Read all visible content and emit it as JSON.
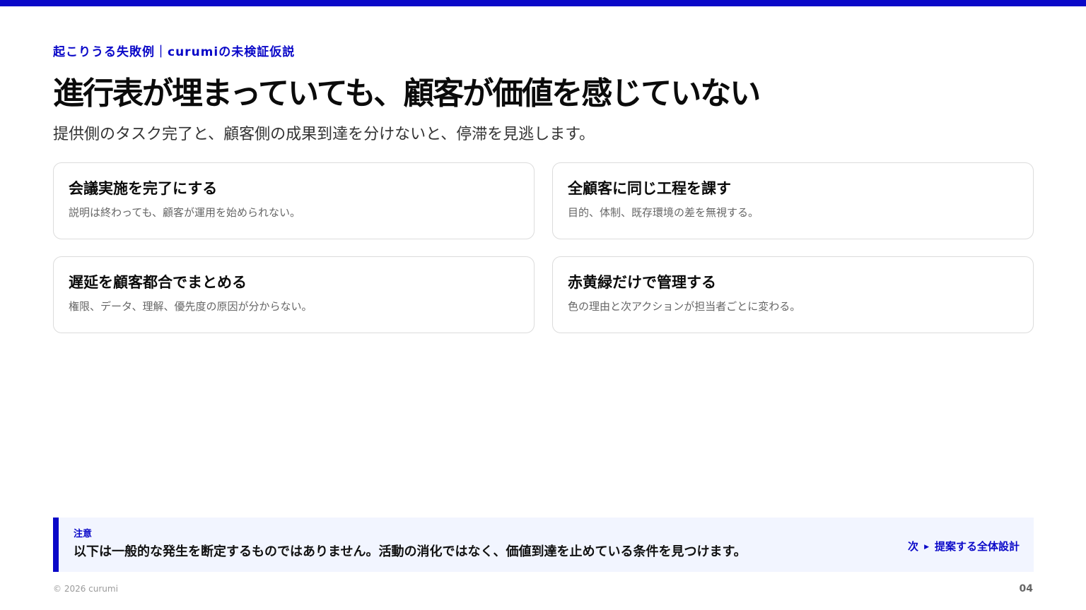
{
  "header": {
    "eyebrow": "起こりうる失敗例｜curumiの未検証仮説",
    "title": "進行表が埋まっていても、顧客が価値を感じていない",
    "subtitle": "提供側のタスク完了と、顧客側の成果到達を分けないと、停滞を見逃します。"
  },
  "cards": [
    {
      "title": "会議実施を完了にする",
      "description": "説明は終わっても、顧客が運用を始められない。"
    },
    {
      "title": "全顧客に同じ工程を課す",
      "description": "目的、体制、既存環境の差を無視する。"
    },
    {
      "title": "遅延を顧客都合でまとめる",
      "description": "権限、データ、理解、優先度の原因が分からない。"
    },
    {
      "title": "赤黄緑だけで管理する",
      "description": "色の理由と次アクションが担当者ごとに変わる。"
    }
  ],
  "notice": {
    "label": "注意",
    "text": "以下は一般的な発生を断定するものではありません。活動の消化ではなく、価値到達を止めている条件を見つけます。",
    "next_prefix": "次",
    "next_arrow": "▶",
    "next_label": "提案する全体設計"
  },
  "footer": {
    "copyright": "© 2026 curumi",
    "page_number": "04"
  },
  "colors": {
    "accent": "#0a08c8",
    "notice_background": "#f2f5ff",
    "card_border": "#dcdcdc"
  }
}
